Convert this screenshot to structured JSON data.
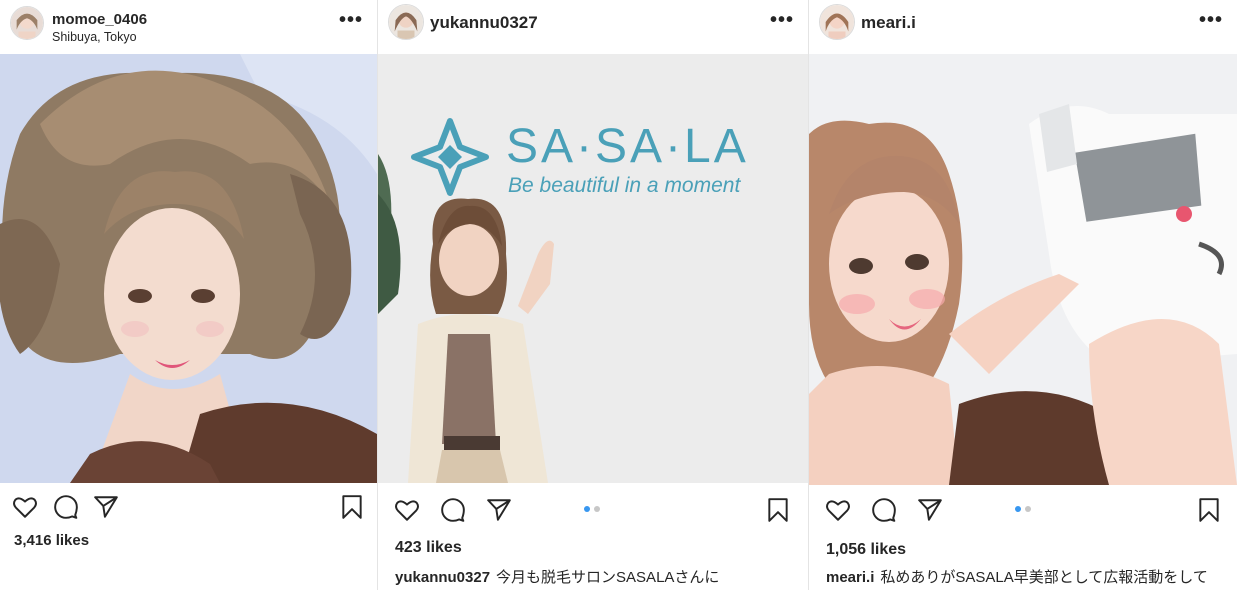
{
  "posts": [
    {
      "username": "momoe_0406",
      "location": "Shibuya, Tokyo",
      "more_label": "•••",
      "likes": "3,416 likes",
      "caption_user": "",
      "caption_text": "",
      "has_carousel": false
    },
    {
      "username": "yukannu0327",
      "location": "",
      "more_label": "•••",
      "likes": "423 likes",
      "caption_user": "yukannu0327",
      "caption_text": "今月も脱毛サロンSASALAさんに",
      "has_carousel": true,
      "photo_sign_title": "SA·SA·LA",
      "photo_sign_tagline": "Be beautiful in a moment"
    },
    {
      "username": "meari.i",
      "location": "",
      "more_label": "•••",
      "likes": "1,056 likes",
      "caption_user": "meari.i",
      "caption_text": "私めありがSASALA早美部として広報活動をして",
      "has_carousel": true
    }
  ],
  "icons": {
    "like": "heart-icon",
    "comment": "comment-icon",
    "share": "paper-plane-icon",
    "save": "bookmark-icon",
    "more": "more-options-icon"
  },
  "colors": {
    "text": "#262626",
    "carousel_active": "#3897f0",
    "carousel_inactive": "#c7c7c7",
    "divider": "#dbdbdb",
    "sign": "#4aa0b8"
  }
}
